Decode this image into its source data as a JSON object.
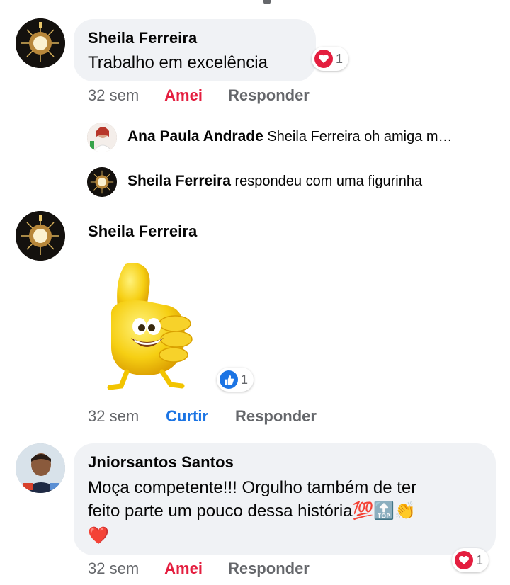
{
  "comments": [
    {
      "author": "Sheila Ferreira",
      "text": "Trabalho em excelência",
      "reaction_count": "1",
      "time": "32 sem",
      "reaction_label": "Amei",
      "reply_label": "Responder"
    },
    {
      "author": "Sheila Ferreira",
      "reaction_count": "1",
      "time": "32 sem",
      "reaction_label": "Curtir",
      "reply_label": "Responder"
    },
    {
      "author": "Jniorsantos Santos",
      "text_line1": "Moça competente!!! Orgulho também de ter",
      "text_line2": "feito parte um pouco dessa história💯🔝👏",
      "text_line3": "❤️",
      "reaction_count": "1",
      "time": "32 sem",
      "reaction_label": "Amei",
      "reply_label": "Responder"
    }
  ],
  "replies": [
    {
      "author": "Ana Paula Andrade",
      "text": "Sheila Ferreira oh amiga m…"
    },
    {
      "author": "Sheila Ferreira",
      "text": "respondeu com uma figurinha"
    }
  ],
  "colors": {
    "love": "#e41e3f",
    "like": "#1b74e4",
    "bubble": "#f0f2f5",
    "meta": "#65676b"
  }
}
